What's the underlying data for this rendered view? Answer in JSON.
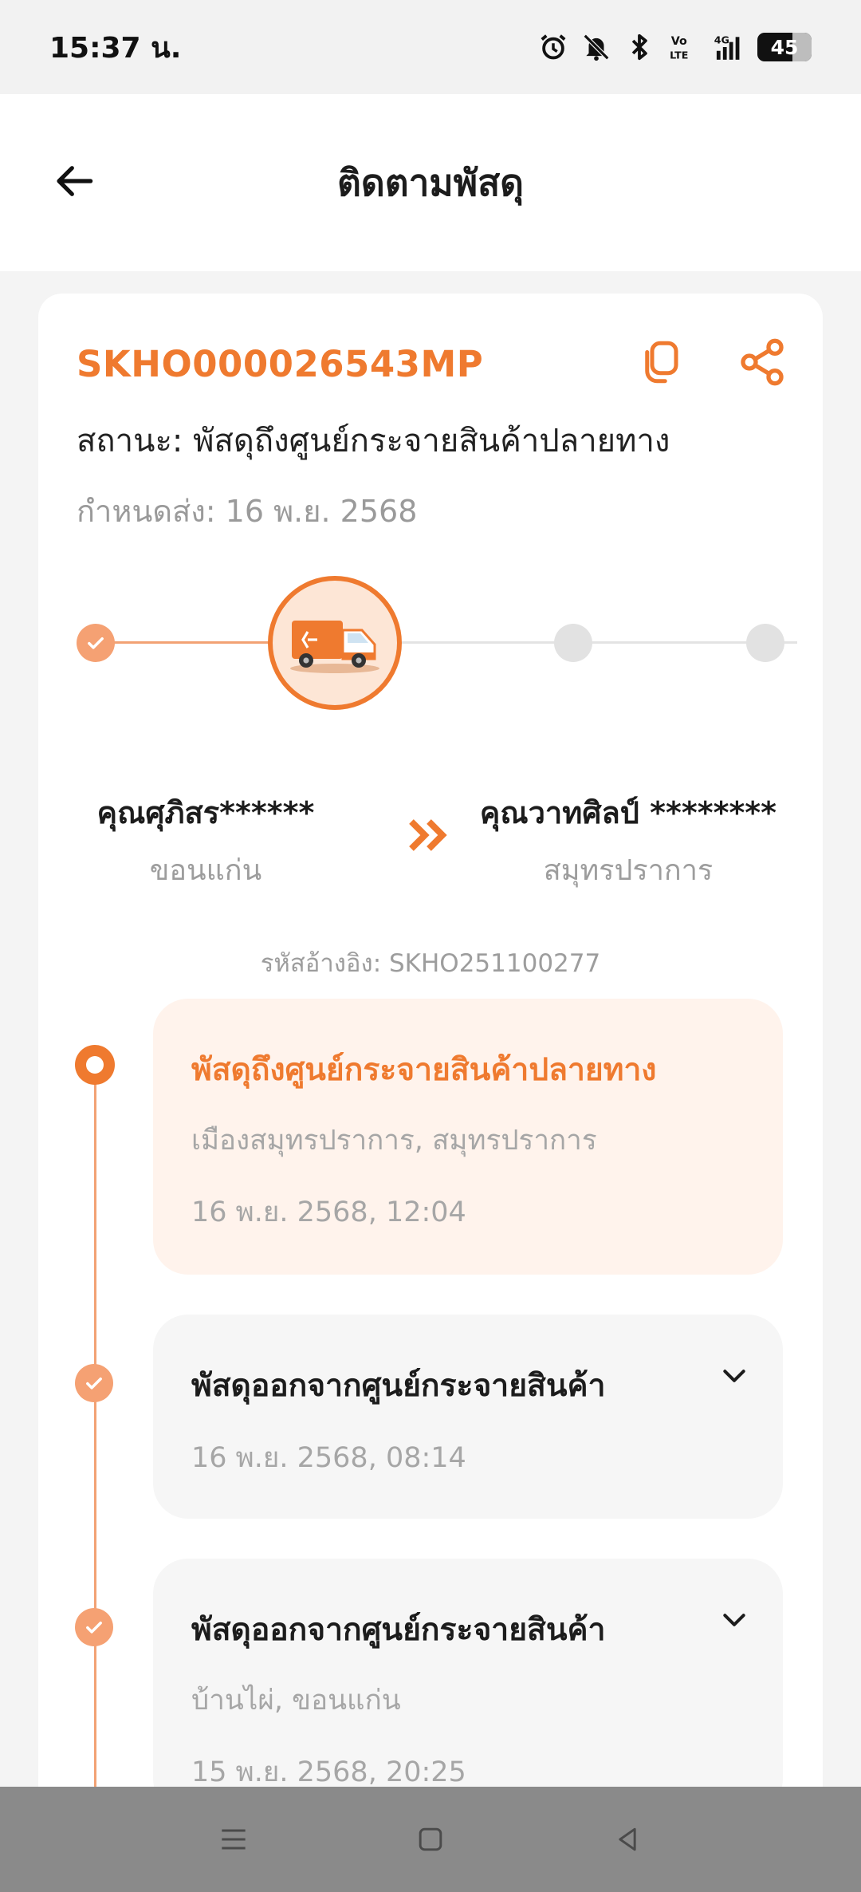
{
  "status_bar": {
    "time": "15:37 น.",
    "battery": "45",
    "icons": [
      "alarm-icon",
      "bell-off-icon",
      "bluetooth-icon",
      "volte-icon",
      "signal-4g-icon",
      "battery-icon"
    ]
  },
  "header": {
    "title": "ติดตามพัสดุ",
    "back_icon": "arrow-left-icon"
  },
  "shipment": {
    "tracking_number": "SKHO000026543MP",
    "status": "สถานะ: พัสดุถึงศูนย์กระจายสินค้าปลายทาง",
    "due": "กำหนดส่ง: 16 พ.ย. 2568",
    "progress_step": 2,
    "progress_total": 4,
    "sender": {
      "name": "คุณศุภิสร******",
      "city": "ขอนแก่น"
    },
    "receiver": {
      "name": "คุณวาทศิลป์ ********",
      "city": "สมุทรปราการ"
    },
    "reference": "รหัสอ้างอิง: SKHO251100277"
  },
  "events": [
    {
      "title": "พัสดุถึงศูนย์กระจายสินค้าปลายทาง",
      "location": "เมืองสมุทรปราการ, สมุทรปราการ",
      "time": "16 พ.ย. 2568, 12:04"
    },
    {
      "title": "พัสดุออกจากศูนย์กระจายสินค้า",
      "time": "16 พ.ย. 2568, 08:14"
    },
    {
      "title": "พัสดุออกจากศูนย์กระจายสินค้า",
      "location": "บ้านไผ่, ขอนแก่น",
      "time": "15 พ.ย. 2568, 20:25"
    }
  ],
  "colors": {
    "accent": "#ef7a2f",
    "accent_light": "#f5a173",
    "active_card_bg": "#fff3ec",
    "inactive_card_bg": "#f6f6f6"
  },
  "nav_bar": [
    "menu-icon",
    "home-square-icon",
    "back-triangle-icon"
  ]
}
